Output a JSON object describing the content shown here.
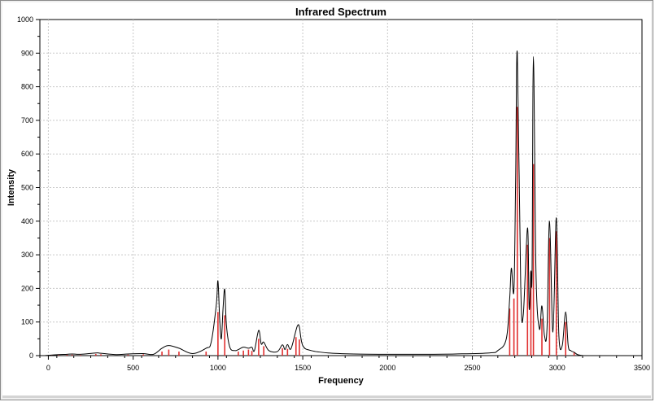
{
  "chart_data": {
    "type": "line",
    "title": "Infrared Spectrum",
    "xlabel": "Frequency",
    "ylabel": "Intensity",
    "xlim": [
      -50,
      3500
    ],
    "ylim": [
      0,
      1000
    ],
    "x_ticks": [
      0,
      500,
      1000,
      1500,
      2000,
      2500,
      3000,
      3500
    ],
    "x_tick_labels": [
      "0",
      "500",
      "1000",
      "1500",
      "2000",
      "2500",
      "3000",
      "3500"
    ],
    "y_ticks": [
      0,
      100,
      200,
      300,
      400,
      500,
      600,
      700,
      800,
      900,
      1000
    ],
    "y_tick_labels": [
      "0",
      "100",
      "200",
      "300",
      "400",
      "500",
      "600",
      "700",
      "800",
      "900",
      "1000"
    ],
    "grid": true,
    "colors": {
      "spectrum_line": "#000000",
      "stick_lines": "#e03030",
      "grid": "#c8c8c8"
    },
    "series": [
      {
        "type": "stick",
        "x": [
          20,
          60,
          110,
          140,
          190,
          280,
          310,
          470,
          560,
          670,
          710,
          770,
          930,
          1000,
          1040,
          1120,
          1150,
          1180,
          1200,
          1240,
          1270,
          1380,
          1410,
          1460,
          1480,
          2720,
          2745,
          2765,
          2825,
          2845,
          2860,
          2910,
          2955,
          2995,
          3050,
          3100
        ],
        "values": [
          2,
          2,
          3,
          3,
          2,
          5,
          4,
          3,
          4,
          12,
          18,
          12,
          12,
          130,
          120,
          12,
          15,
          18,
          14,
          50,
          28,
          22,
          20,
          55,
          48,
          140,
          170,
          740,
          330,
          250,
          570,
          110,
          350,
          370,
          100,
          10
        ]
      },
      {
        "type": "line",
        "x": [
          -20,
          0,
          60,
          110,
          140,
          190,
          280,
          310,
          400,
          470,
          560,
          620,
          670,
          710,
          770,
          850,
          930,
          960,
          990,
          1000,
          1010,
          1020,
          1030,
          1040,
          1050,
          1070,
          1100,
          1120,
          1150,
          1180,
          1200,
          1215,
          1240,
          1255,
          1270,
          1300,
          1350,
          1380,
          1395,
          1410,
          1430,
          1460,
          1470,
          1480,
          1500,
          1550,
          1650,
          1800,
          2000,
          2200,
          2400,
          2600,
          2650,
          2700,
          2720,
          2730,
          2745,
          2755,
          2765,
          2785,
          2800,
          2825,
          2835,
          2845,
          2852,
          2860,
          2875,
          2895,
          2910,
          2925,
          2940,
          2955,
          2975,
          2995,
          3010,
          3030,
          3050,
          3065,
          3080,
          3100,
          3120,
          3150
        ],
        "values": [
          0,
          1,
          3,
          4,
          5,
          4,
          8,
          7,
          3,
          5,
          6,
          4,
          22,
          30,
          22,
          6,
          22,
          40,
          150,
          222,
          110,
          50,
          140,
          197,
          90,
          25,
          15,
          18,
          25,
          22,
          25,
          15,
          75,
          35,
          40,
          15,
          12,
          32,
          18,
          33,
          20,
          75,
          90,
          85,
          30,
          15,
          8,
          5,
          4,
          4,
          5,
          8,
          15,
          50,
          170,
          260,
          195,
          520,
          900,
          210,
          120,
          380,
          140,
          250,
          250,
          890,
          250,
          80,
          148,
          60,
          80,
          400,
          70,
          410,
          60,
          30,
          130,
          30,
          15,
          10,
          3,
          0
        ]
      }
    ]
  }
}
